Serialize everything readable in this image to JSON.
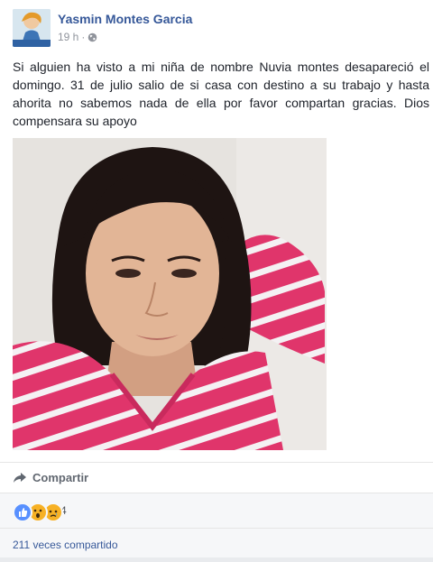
{
  "post": {
    "author": "Yasmin Montes Garcia",
    "time": "19 h",
    "separator": "·",
    "text": "Si alguien ha visto a mi niña de nombre Nuvia montes desapareció el domingo. 31 de julio salio de si casa con destino a su trabajo y hasta ahorita no sabemos nada de ella por favor compartan gracias. Dios compensara su apoyo"
  },
  "actions": {
    "share_label": "Compartir"
  },
  "reactions": {
    "icons": [
      "like-icon",
      "wow-icon",
      "sad-icon"
    ],
    "count": "4"
  },
  "shares": {
    "label": "211 veces compartido"
  },
  "colors": {
    "link": "#365899",
    "text": "#1d2129",
    "muted": "#90949c",
    "like": "#5890ff",
    "emoji": "#f7b125"
  }
}
